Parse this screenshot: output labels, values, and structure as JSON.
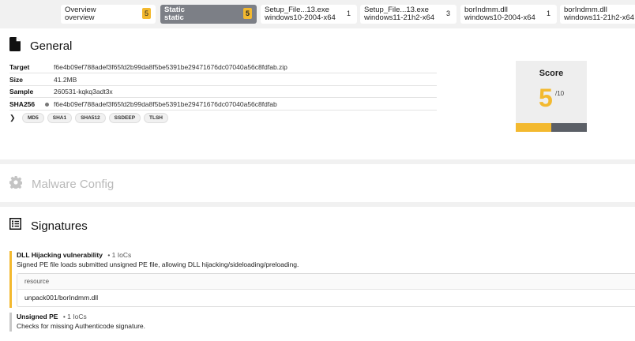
{
  "tabs": [
    {
      "line1": "Overview",
      "line2": "overview",
      "count": "5",
      "badge": true,
      "active": false
    },
    {
      "line1": "Static",
      "line2": "static",
      "count": "5",
      "badge": true,
      "active": true
    },
    {
      "line1": "Setup_File...13.exe",
      "line2": "windows10-2004-x64",
      "count": "1",
      "badge": false,
      "active": false
    },
    {
      "line1": "Setup_File...13.exe",
      "line2": "windows11-21h2-x64",
      "count": "3",
      "badge": false,
      "active": false
    },
    {
      "line1": "borIndmm.dll",
      "line2": "windows10-2004-x64",
      "count": "1",
      "badge": false,
      "active": false
    },
    {
      "line1": "borIndmm.dll",
      "line2": "windows11-21h2-x64",
      "count": "",
      "badge": false,
      "active": false
    }
  ],
  "general": {
    "title": "General",
    "rows": [
      {
        "key": "Target",
        "value": "f6e4b09ef788adef3f65fd2b99da8f5be5391be29471676dc07040a56c8fdfab.zip"
      },
      {
        "key": "Size",
        "value": "41.2MB"
      },
      {
        "key": "Sample",
        "value": "260531-kqkq3adt3x"
      },
      {
        "key": "SHA256",
        "value": "f6e4b09ef788adef3f65fd2b99da8f5be5391be29471676dc07040a56c8fdfab"
      }
    ],
    "hashes": [
      "MD5",
      "SHA1",
      "SHA512",
      "SSDEEP",
      "TLSH"
    ]
  },
  "score": {
    "label": "Score",
    "value": "5",
    "denominator": "/10",
    "fraction": 0.5,
    "accent": "#f3b92f",
    "rest_color": "#5b5f66"
  },
  "malware_config": {
    "title": "Malware Config"
  },
  "signatures": {
    "title": "Signatures",
    "items": [
      {
        "title": "DLL Hijacking vulnerability",
        "iocs": "• 1 IoCs",
        "description": "Signed PE file loads submitted unsigned PE file, allowing DLL hijacking/sideloading/preloading.",
        "resource_header": "resource",
        "resource_value": "unpack001/borIndmm.dll"
      },
      {
        "title": "Unsigned PE",
        "iocs": "• 1 IoCs",
        "description": "Checks for missing Authenticode signature."
      }
    ]
  }
}
